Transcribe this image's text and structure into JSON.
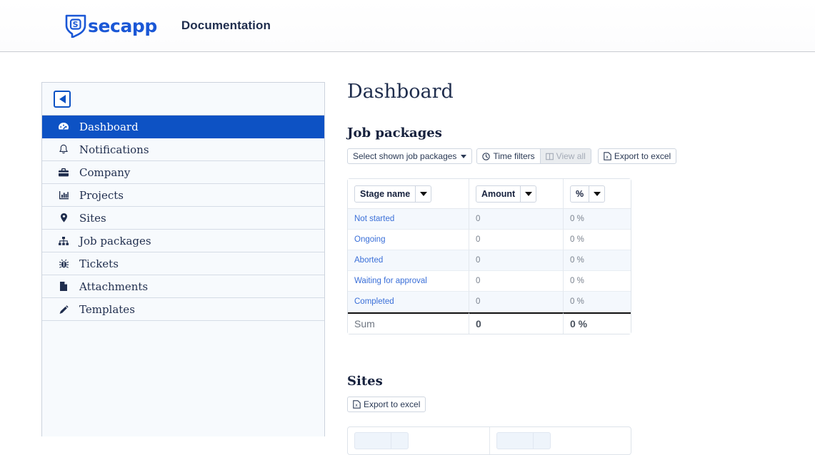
{
  "navbar": {
    "brand_name": "secapp",
    "brand_icon": "shield-s-logo",
    "doc_link": "Documentation"
  },
  "sidebar": {
    "collapse_icon": "caret-left-square-icon",
    "items": [
      {
        "label": "Dashboard",
        "icon": "tachometer-icon",
        "active": true
      },
      {
        "label": "Notifications",
        "icon": "bell-icon",
        "active": false
      },
      {
        "label": "Company",
        "icon": "briefcase-icon",
        "active": false
      },
      {
        "label": "Projects",
        "icon": "bar-chart-icon",
        "active": false
      },
      {
        "label": "Sites",
        "icon": "map-pin-icon",
        "active": false
      },
      {
        "label": "Job packages",
        "icon": "sitemap-icon",
        "active": false
      },
      {
        "label": "Tickets",
        "icon": "bug-icon",
        "active": false
      },
      {
        "label": "Attachments",
        "icon": "file-icon",
        "active": false
      },
      {
        "label": "Templates",
        "icon": "pencil-icon",
        "active": false
      }
    ]
  },
  "main": {
    "page_title": "Dashboard",
    "job_packages": {
      "section_title": "Job packages",
      "toolbar": {
        "select_label": "Select shown job packages",
        "time_filters_label": "Time filters",
        "time_filters_icon": "clock-icon",
        "view_all_label": "View all",
        "view_all_icon": "columns-icon",
        "view_all_disabled": true,
        "export_label": "Export to excel",
        "export_icon": "file-excel-icon"
      },
      "columns": [
        "Stage name",
        "Amount",
        "%"
      ],
      "rows": [
        {
          "stage": "Not started",
          "amount": "0",
          "percent": "0 %"
        },
        {
          "stage": "Ongoing",
          "amount": "0",
          "percent": "0 %"
        },
        {
          "stage": "Aborted",
          "amount": "0",
          "percent": "0 %"
        },
        {
          "stage": "Waiting for approval",
          "amount": "0",
          "percent": "0 %"
        },
        {
          "stage": "Completed",
          "amount": "0",
          "percent": "0 %"
        }
      ],
      "sum_row": {
        "label": "Sum",
        "amount": "0",
        "percent": "0 %"
      }
    },
    "sites": {
      "section_title": "Sites",
      "export_label": "Export to excel",
      "export_icon": "file-excel-icon"
    }
  },
  "colors": {
    "brand_blue": "#1a57d6",
    "active_nav": "#0d52c4",
    "link_blue": "#3a6fd8",
    "text_navy": "#1f2d4d",
    "sidebar_bg": "#f7fafd",
    "row_alt_bg": "#f4f8fd"
  }
}
